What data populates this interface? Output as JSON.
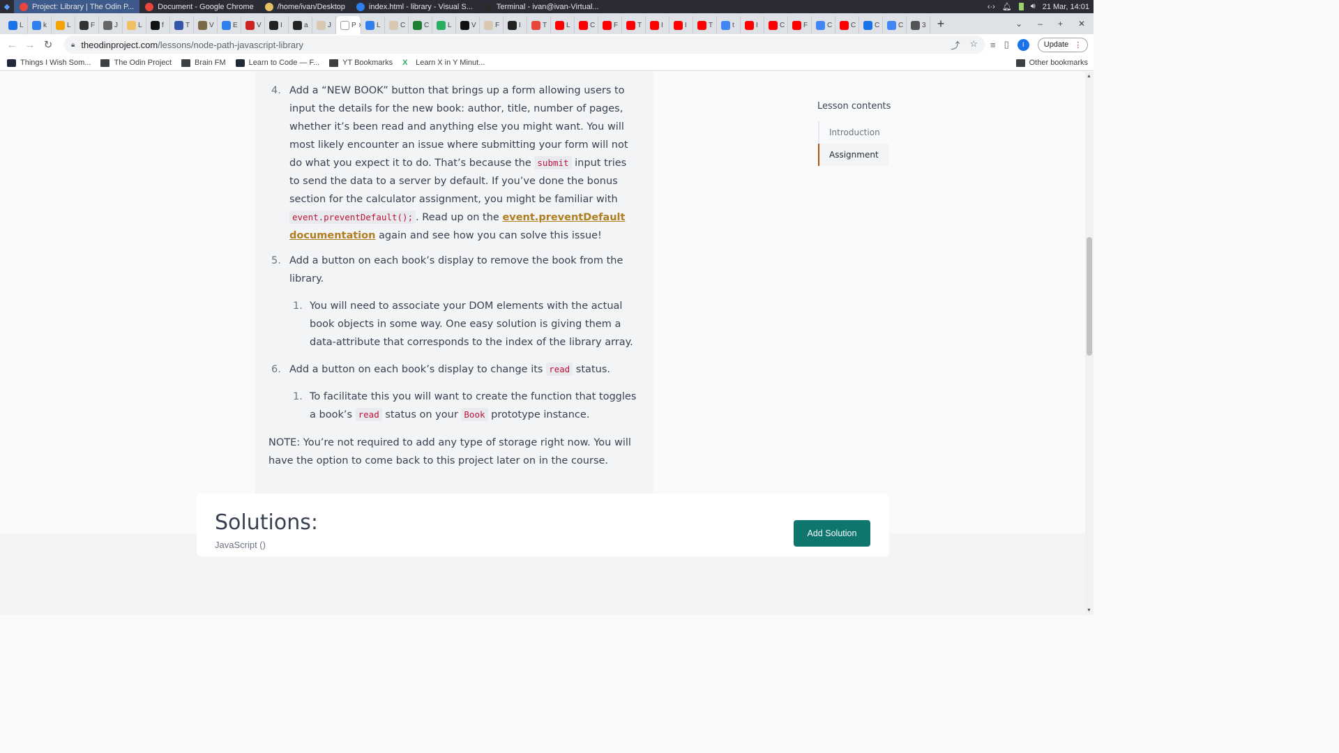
{
  "taskbar": {
    "windows": [
      {
        "title": "Project: Library | The Odin P...",
        "color": "#e8453c"
      },
      {
        "title": "Document - Google Chrome",
        "color": "#e8453c"
      },
      {
        "title": "/home/ivan/Desktop",
        "color": "#e6c065"
      },
      {
        "title": "index.html - library - Visual S...",
        "color": "#2f80ed"
      },
      {
        "title": "Terminal - ivan@ivan-Virtual...",
        "color": "#2b2b2b"
      }
    ],
    "clock": "21 Mar, 14:01"
  },
  "tabs": [
    {
      "label": "L",
      "color": "#1a73e8"
    },
    {
      "label": "k",
      "color": "#2f80ed"
    },
    {
      "label": "L",
      "color": "#f4a300"
    },
    {
      "label": "F",
      "color": "#333333"
    },
    {
      "label": "J",
      "color": "#666666"
    },
    {
      "label": "L",
      "color": "#f0c060"
    },
    {
      "label": "f",
      "color": "#111111"
    },
    {
      "label": "T",
      "color": "#3355aa"
    },
    {
      "label": "V",
      "color": "#7a6a4a"
    },
    {
      "label": "E",
      "color": "#2f80ed"
    },
    {
      "label": "V",
      "color": "#cc2222"
    },
    {
      "label": "I",
      "color": "#222222"
    },
    {
      "label": "a",
      "color": "#222222"
    },
    {
      "label": "J",
      "color": "#d8c8b0"
    },
    {
      "label": "P",
      "color": "#ffffff",
      "active": true
    },
    {
      "label": "L",
      "color": "#2f80ed"
    },
    {
      "label": "C",
      "color": "#d8c8b0"
    },
    {
      "label": "C",
      "color": "#1e7e34"
    },
    {
      "label": "L",
      "color": "#27ae60"
    },
    {
      "label": "V",
      "color": "#111111"
    },
    {
      "label": "F",
      "color": "#d8c8b0"
    },
    {
      "label": "I",
      "color": "#222222"
    },
    {
      "label": "T",
      "color": "#e8453c"
    },
    {
      "label": "L",
      "color": "#ff0000"
    },
    {
      "label": "C",
      "color": "#ff0000"
    },
    {
      "label": "F",
      "color": "#ff0000"
    },
    {
      "label": "T",
      "color": "#ff0000"
    },
    {
      "label": "I",
      "color": "#ff0000"
    },
    {
      "label": "I",
      "color": "#ff0000"
    },
    {
      "label": "T",
      "color": "#ff0000"
    },
    {
      "label": "t",
      "color": "#4285f4"
    },
    {
      "label": "I",
      "color": "#ff0000"
    },
    {
      "label": "C",
      "color": "#ff0000"
    },
    {
      "label": "F",
      "color": "#ff0000"
    },
    {
      "label": "C",
      "color": "#4285f4"
    },
    {
      "label": "C",
      "color": "#ff0000"
    },
    {
      "label": "C",
      "color": "#1a73e8"
    },
    {
      "label": "C",
      "color": "#4285f4"
    },
    {
      "label": "3",
      "color": "#555555"
    }
  ],
  "toolbar": {
    "url_domain": "theodinproject.com",
    "url_path": "/lessons/node-path-javascript-library",
    "update_label": "Update",
    "profile_initial": "I"
  },
  "bookmarks": {
    "items": [
      {
        "label": "Things I Wish Som...",
        "icon": "letter-icon"
      },
      {
        "label": "The Odin Project",
        "icon": "folder-icon"
      },
      {
        "label": "Brain FM",
        "icon": "folder-icon"
      },
      {
        "label": "Learn to Code — F...",
        "icon": "letter-icon"
      },
      {
        "label": "YT Bookmarks",
        "icon": "folder-icon"
      },
      {
        "label": "Learn X in Y Minut...",
        "icon": "x-icon"
      }
    ],
    "other": "Other bookmarks"
  },
  "lesson": {
    "item4": {
      "num": "4.",
      "p1": "Add a “NEW BOOK” button that brings up a form allowing users to input the details for the new book: author, title, number of pages, whether it’s been read and anything else you might want. You will most likely encounter an issue where submitting your form will not do what you expect it to do. That’s because the ",
      "code1": "submit",
      "p2": " input tries to send the data to a server by default. If you’ve done the bonus section for the calculator assignment, you might be familiar with ",
      "code2": "event.preventDefault();",
      "p3": ". Read up on the ",
      "link": "event.preventDefault documentation",
      "p4": " again and see how you can solve this issue!"
    },
    "item5": {
      "num": "5.",
      "text": "Add a button on each book’s display to remove the book from the library.",
      "sub_num": "1.",
      "sub_text": "You will need to associate your DOM elements with the actual book objects in some way. One easy solution is giving them a data-attribute that corresponds to the index of the library array."
    },
    "item6": {
      "num": "6.",
      "p1": "Add a button on each book’s display to change its ",
      "code1": "read",
      "p2": " status.",
      "sub_num": "1.",
      "sub_p1": "To facilitate this you will want to create the function that toggles a book’s ",
      "sub_code1": "read",
      "sub_p2": " status on your ",
      "sub_code2": "Book",
      "sub_p3": " prototype instance."
    },
    "note": "NOTE: You’re not required to add any type of storage right now. You will have the option to come back to this project later on in the course."
  },
  "toc": {
    "title": "Lesson contents",
    "items": [
      "Introduction",
      "Assignment"
    ],
    "active": "Assignment"
  },
  "solutions": {
    "title": "Solutions:",
    "subtitle": "JavaScript ()",
    "add_button": "Add Solution"
  }
}
